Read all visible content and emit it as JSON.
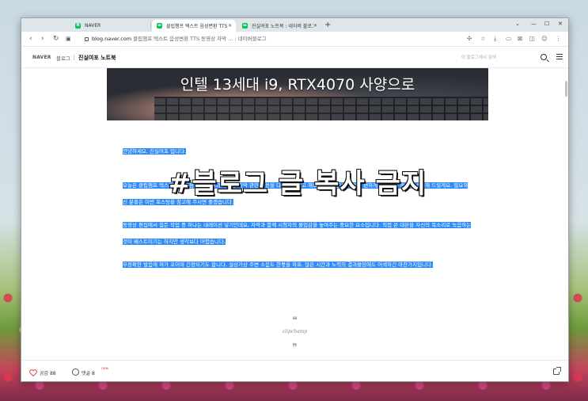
{
  "browser": {
    "tabs": [
      {
        "title": "NAVER",
        "favicon": "naver-favicon",
        "active": false
      },
      {
        "title": "클립챔프 텍스트 음성변환 TTS",
        "favicon": "blog-favicon",
        "active": true
      },
      {
        "title": "진실여포 노트북 : 네이버 블로그",
        "favicon": "blog-favicon",
        "active": false
      }
    ],
    "new_tab_label": "+",
    "window_controls": [
      "⌄",
      "—",
      "☐",
      "✕"
    ],
    "address": {
      "host": "blog.naver.com",
      "rest": " 클립챔프 텍스트 음성변환 TTS 동영상 자막 ... : 네이버블로그"
    },
    "nav_icons": [
      "back-icon",
      "forward-icon",
      "reload-icon",
      "apps-icon"
    ],
    "toolbar_icons": [
      "extension-icon",
      "star-icon",
      "download-icon",
      "tab-icon",
      "screenshot-icon",
      "sidebar-icon",
      "profile-icon",
      "more-icon"
    ]
  },
  "blog_header": {
    "logo": "NAVER",
    "blog_label": "블로그",
    "blog_name": "진실여포 노트북",
    "search_placeholder": "이 블로그에서 검색"
  },
  "hero": {
    "caption": "인텔 13세대 i9, RTX4070 사양으로"
  },
  "article": {
    "greeting": "안녕하세요, 진실여포 입니다.",
    "para1": "오늘은 클립챔프 텍스트 음성변환 TTS 기능과 동영상 자막 관련 내용을 다루어 보려고 해요. 짧은 시간으로 쉽고 편하게 사용하는 방법을 소개해 드릴게요. 필요하신 분들은 이번 포스팅을 참고해 주시면 좋겠습니다.",
    "para2": "동영상 편집에서 힘든 작업 중 하나는 내레이션 넣기인데요, 자막과 함께 시청자의 몰입감을 높여주는 중요한 요소입니다. 직접 쓴 대본을 자신의 목소리로 녹음하는 것이 베스트이기는 하지만 생각보다 어렵습니다.",
    "para3": "부정확한 발음에 혀가 꼬이며 긴장되기도 합니다. 설상가상 주변 소음도 한몫을 하죠. 많은 시간과 노력의 결과물임에도 어색하긴 마찬가지입니다."
  },
  "watermark": "#블로그 글 복사 금지",
  "quote": {
    "open": "❝",
    "text": "clipchamp",
    "close": "❞"
  },
  "footer": {
    "like_label": "공감 88",
    "comment_label": "댓글 8",
    "new_badge": "new",
    "share_icon": "share-icon"
  },
  "colors": {
    "selection": "#2f8bf7",
    "naver_green": "#03c75a",
    "like_heart": "#e34b4b"
  }
}
